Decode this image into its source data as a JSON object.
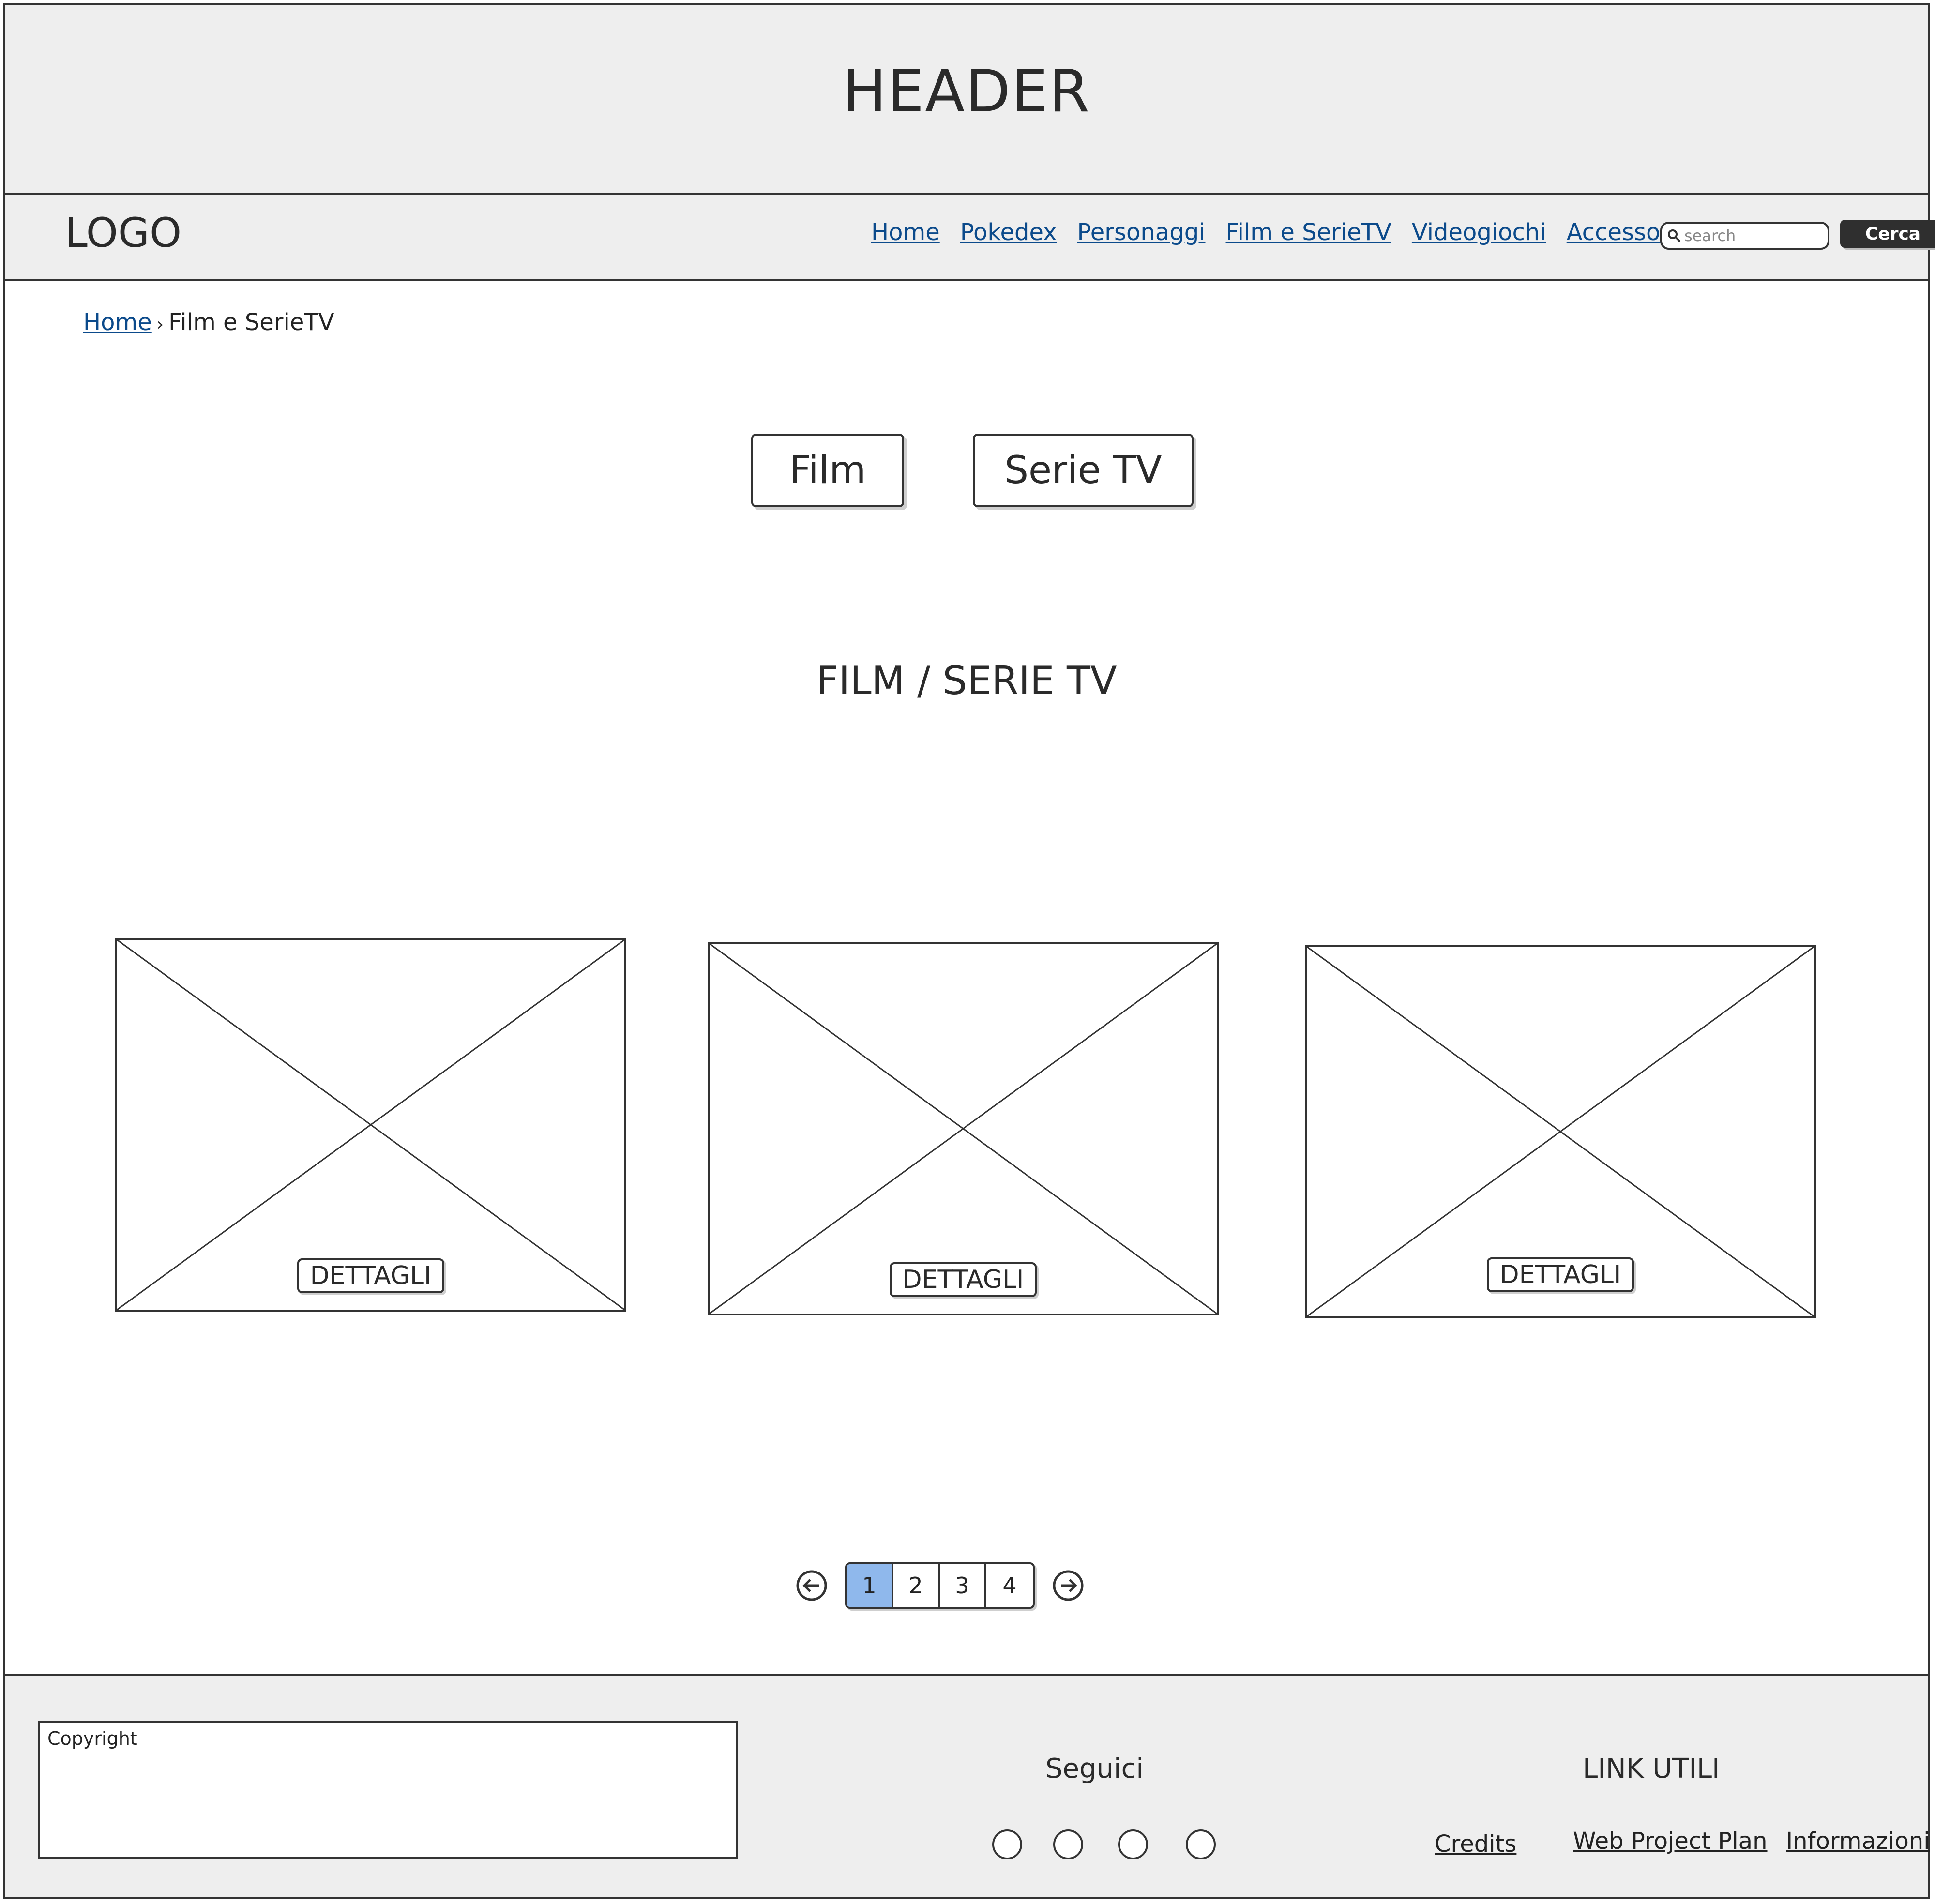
{
  "header": {
    "title": "HEADER"
  },
  "navbar": {
    "logo": "LOGO",
    "links": [
      "Home",
      "Pokedex",
      "Personaggi",
      "Film e SerieTV",
      "Videogiochi",
      "Accesso"
    ],
    "search_placeholder": "search",
    "search_button": "Cerca"
  },
  "breadcrumb": {
    "home": "Home",
    "separator": "›",
    "current": "Film e SerieTV"
  },
  "tabs": {
    "film": "Film",
    "serie": "Serie TV"
  },
  "section": {
    "title": "FILM / SERIE TV"
  },
  "cards": [
    {
      "button": "DETTAGLI"
    },
    {
      "button": "DETTAGLI"
    },
    {
      "button": "DETTAGLI"
    }
  ],
  "pagination": {
    "pages": [
      "1",
      "2",
      "3",
      "4"
    ],
    "active_page": "1",
    "active_color": "#8fb8ec"
  },
  "footer": {
    "copyright": "Copyright",
    "follow_title": "Seguici",
    "links_title": "LINK UTILI",
    "links": [
      "Credits",
      "Web Project Plan",
      "Informazioni"
    ]
  }
}
